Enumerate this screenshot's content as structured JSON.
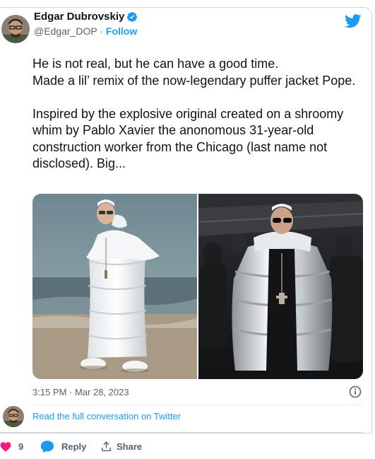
{
  "tweet": {
    "author_name": "Edgar Dubrovskiy",
    "handle": "@Edgar_DOP",
    "separator": "·",
    "follow_label": "Follow",
    "text": "He is not real, but he can have a good time.\nMade a lil’ remix of the now-legendary puffer jacket Pope.\n\nInspired by the explosive original created on a shroomy whim by Pablo Xavier the anonomous 31-year-old construction worker from the Chicago (last name not disclosed). Big...",
    "timestamp": "3:15 PM · Mar 28, 2023",
    "conversation_link": "Read the full conversation on Twitter"
  },
  "actions": {
    "like_count": "9",
    "reply_label": "Reply",
    "share_label": "Share"
  },
  "icons": {
    "twitter_logo": "twitter-bird-icon",
    "verified": "verified-badge-icon",
    "info": "info-icon",
    "like": "heart-icon",
    "reply": "speech-bubble-icon",
    "share": "share-arrow-icon"
  },
  "colors": {
    "accent": "#1d9bf0",
    "like": "#f91880",
    "text": "#0f1419",
    "muted": "#536471"
  }
}
